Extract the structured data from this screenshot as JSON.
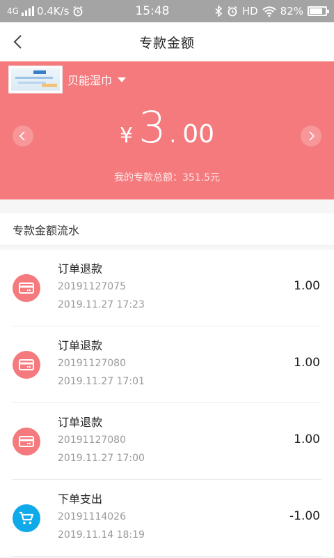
{
  "status_bar": {
    "network_type": "4G",
    "speed": "0.4K/s",
    "time": "15:48",
    "hd": "HD",
    "battery_percent": "82%",
    "battery_level": 0.82
  },
  "nav": {
    "title": "专款金额"
  },
  "hero": {
    "product_name": "贝能湿巾",
    "currency_symbol": "¥",
    "amount_int": "3.",
    "amount_dec": "00",
    "total_line": "我的专款总额：351.5元",
    "color": "#f57a7d"
  },
  "section": {
    "title": "专款金额流水"
  },
  "transactions": [
    {
      "title": "订单退款",
      "order_no": "20191127075",
      "datetime": "2019.11.27 17:23",
      "amount": "1.00",
      "icon": "card-icon",
      "icon_color": "#f57a7d"
    },
    {
      "title": "订单退款",
      "order_no": "20191127080",
      "datetime": "2019.11.27 17:01",
      "amount": "1.00",
      "icon": "card-icon",
      "icon_color": "#f57a7d"
    },
    {
      "title": "订单退款",
      "order_no": "20191127080",
      "datetime": "2019.11.27 17:00",
      "amount": "1.00",
      "icon": "card-icon",
      "icon_color": "#f57a7d"
    },
    {
      "title": "下单支出",
      "order_no": "20191114026",
      "datetime": "2019.11.14 18:19",
      "amount": "-1.00",
      "icon": "cart-icon",
      "icon_color": "#10a9ea"
    }
  ]
}
